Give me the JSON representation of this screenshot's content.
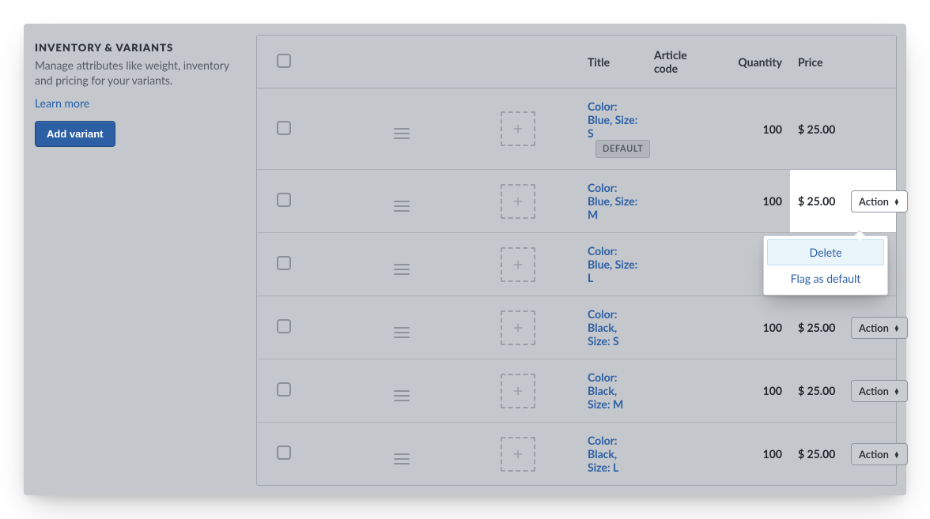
{
  "sidebar": {
    "heading": "INVENTORY & VARIANTS",
    "description": "Manage attributes like weight, inventory and pricing for your variants.",
    "learn_more_label": "Learn more",
    "add_variant_label": "Add variant"
  },
  "table": {
    "headers": {
      "title": "Title",
      "article_code": "Article code",
      "quantity": "Quantity",
      "price": "Price"
    },
    "default_badge": "DEFAULT",
    "action_label": "Action",
    "rows": [
      {
        "title": "Color: Blue, Size: S",
        "article_code": "",
        "quantity": "100",
        "price": "$ 25.00",
        "is_default": true,
        "menu_open": false,
        "show_action": false
      },
      {
        "title": "Color: Blue, Size: M",
        "article_code": "",
        "quantity": "100",
        "price": "$ 25.00",
        "is_default": false,
        "menu_open": true,
        "show_action": true
      },
      {
        "title": "Color: Blue, Size: L",
        "article_code": "",
        "quantity": "100",
        "price": "",
        "is_default": false,
        "menu_open": false,
        "show_action": false
      },
      {
        "title": "Color: Black, Size: S",
        "article_code": "",
        "quantity": "100",
        "price": "$ 25.00",
        "is_default": false,
        "menu_open": false,
        "show_action": true
      },
      {
        "title": "Color: Black, Size: M",
        "article_code": "",
        "quantity": "100",
        "price": "$ 25.00",
        "is_default": false,
        "menu_open": false,
        "show_action": true
      },
      {
        "title": "Color: Black, Size: L",
        "article_code": "",
        "quantity": "100",
        "price": "$ 25.00",
        "is_default": false,
        "menu_open": false,
        "show_action": true
      }
    ]
  },
  "menu": {
    "delete": "Delete",
    "flag_default": "Flag as default"
  },
  "colors": {
    "accent": "#2d5fa4",
    "panel_bg": "#c4c7cc",
    "border": "#a2a7ad"
  }
}
